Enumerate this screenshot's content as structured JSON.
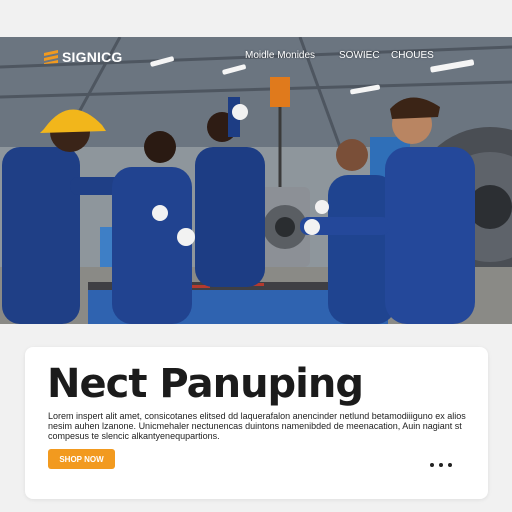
{
  "brand": {
    "name": "SIGNICG",
    "icon": "brand-stripes-icon",
    "accent": "#f29a1f"
  },
  "nav": {
    "links": [
      "Moidle Monides",
      "SOWIEC",
      "CHOUES"
    ]
  },
  "hero": {
    "image": "factory-workers-assembling-machine-photo"
  },
  "card": {
    "headline": "Nect Panuping",
    "body": "Lorem inspert alit amet, consicotanes elitsed dd laquerafalon anencinder netlund betamodiiiguno ex alios nesim auhen lzanone. Unicmehaler nectunencas duintons namenibded de meenacation, Auin nagiant st compesus te slencic alkantyenequpartions.",
    "cta_label": "SHOP NOW",
    "pager_icon": "more-dots-icon"
  }
}
